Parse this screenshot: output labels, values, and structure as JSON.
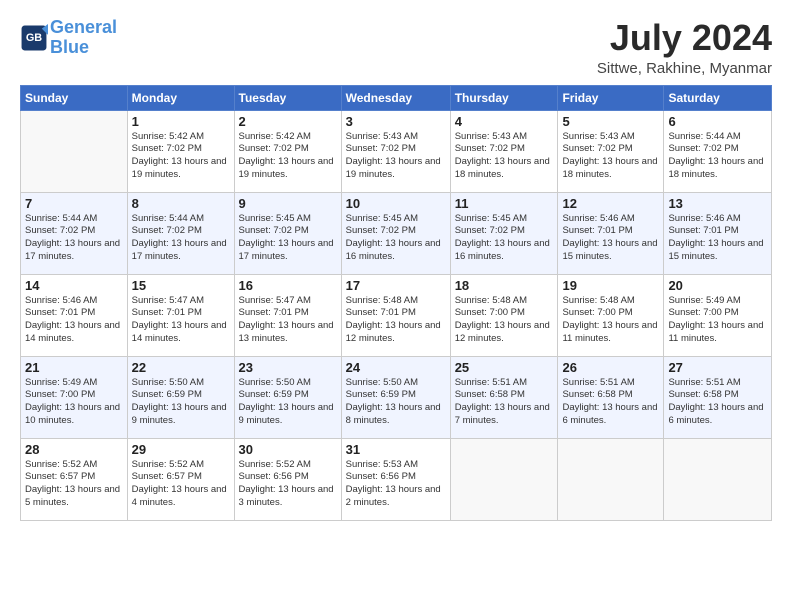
{
  "header": {
    "logo_line1": "General",
    "logo_line2": "Blue",
    "title": "July 2024",
    "location": "Sittwe, Rakhine, Myanmar"
  },
  "weekdays": [
    "Sunday",
    "Monday",
    "Tuesday",
    "Wednesday",
    "Thursday",
    "Friday",
    "Saturday"
  ],
  "weeks": [
    [
      {
        "day": "",
        "sunrise": "",
        "sunset": "",
        "daylight": ""
      },
      {
        "day": "1",
        "sunrise": "5:42 AM",
        "sunset": "7:02 PM",
        "daylight": "13 hours and 19 minutes."
      },
      {
        "day": "2",
        "sunrise": "5:42 AM",
        "sunset": "7:02 PM",
        "daylight": "13 hours and 19 minutes."
      },
      {
        "day": "3",
        "sunrise": "5:43 AM",
        "sunset": "7:02 PM",
        "daylight": "13 hours and 19 minutes."
      },
      {
        "day": "4",
        "sunrise": "5:43 AM",
        "sunset": "7:02 PM",
        "daylight": "13 hours and 18 minutes."
      },
      {
        "day": "5",
        "sunrise": "5:43 AM",
        "sunset": "7:02 PM",
        "daylight": "13 hours and 18 minutes."
      },
      {
        "day": "6",
        "sunrise": "5:44 AM",
        "sunset": "7:02 PM",
        "daylight": "13 hours and 18 minutes."
      }
    ],
    [
      {
        "day": "7",
        "sunrise": "5:44 AM",
        "sunset": "7:02 PM",
        "daylight": "13 hours and 17 minutes."
      },
      {
        "day": "8",
        "sunrise": "5:44 AM",
        "sunset": "7:02 PM",
        "daylight": "13 hours and 17 minutes."
      },
      {
        "day": "9",
        "sunrise": "5:45 AM",
        "sunset": "7:02 PM",
        "daylight": "13 hours and 17 minutes."
      },
      {
        "day": "10",
        "sunrise": "5:45 AM",
        "sunset": "7:02 PM",
        "daylight": "13 hours and 16 minutes."
      },
      {
        "day": "11",
        "sunrise": "5:45 AM",
        "sunset": "7:02 PM",
        "daylight": "13 hours and 16 minutes."
      },
      {
        "day": "12",
        "sunrise": "5:46 AM",
        "sunset": "7:01 PM",
        "daylight": "13 hours and 15 minutes."
      },
      {
        "day": "13",
        "sunrise": "5:46 AM",
        "sunset": "7:01 PM",
        "daylight": "13 hours and 15 minutes."
      }
    ],
    [
      {
        "day": "14",
        "sunrise": "5:46 AM",
        "sunset": "7:01 PM",
        "daylight": "13 hours and 14 minutes."
      },
      {
        "day": "15",
        "sunrise": "5:47 AM",
        "sunset": "7:01 PM",
        "daylight": "13 hours and 14 minutes."
      },
      {
        "day": "16",
        "sunrise": "5:47 AM",
        "sunset": "7:01 PM",
        "daylight": "13 hours and 13 minutes."
      },
      {
        "day": "17",
        "sunrise": "5:48 AM",
        "sunset": "7:01 PM",
        "daylight": "13 hours and 12 minutes."
      },
      {
        "day": "18",
        "sunrise": "5:48 AM",
        "sunset": "7:00 PM",
        "daylight": "13 hours and 12 minutes."
      },
      {
        "day": "19",
        "sunrise": "5:48 AM",
        "sunset": "7:00 PM",
        "daylight": "13 hours and 11 minutes."
      },
      {
        "day": "20",
        "sunrise": "5:49 AM",
        "sunset": "7:00 PM",
        "daylight": "13 hours and 11 minutes."
      }
    ],
    [
      {
        "day": "21",
        "sunrise": "5:49 AM",
        "sunset": "7:00 PM",
        "daylight": "13 hours and 10 minutes."
      },
      {
        "day": "22",
        "sunrise": "5:50 AM",
        "sunset": "6:59 PM",
        "daylight": "13 hours and 9 minutes."
      },
      {
        "day": "23",
        "sunrise": "5:50 AM",
        "sunset": "6:59 PM",
        "daylight": "13 hours and 9 minutes."
      },
      {
        "day": "24",
        "sunrise": "5:50 AM",
        "sunset": "6:59 PM",
        "daylight": "13 hours and 8 minutes."
      },
      {
        "day": "25",
        "sunrise": "5:51 AM",
        "sunset": "6:58 PM",
        "daylight": "13 hours and 7 minutes."
      },
      {
        "day": "26",
        "sunrise": "5:51 AM",
        "sunset": "6:58 PM",
        "daylight": "13 hours and 6 minutes."
      },
      {
        "day": "27",
        "sunrise": "5:51 AM",
        "sunset": "6:58 PM",
        "daylight": "13 hours and 6 minutes."
      }
    ],
    [
      {
        "day": "28",
        "sunrise": "5:52 AM",
        "sunset": "6:57 PM",
        "daylight": "13 hours and 5 minutes."
      },
      {
        "day": "29",
        "sunrise": "5:52 AM",
        "sunset": "6:57 PM",
        "daylight": "13 hours and 4 minutes."
      },
      {
        "day": "30",
        "sunrise": "5:52 AM",
        "sunset": "6:56 PM",
        "daylight": "13 hours and 3 minutes."
      },
      {
        "day": "31",
        "sunrise": "5:53 AM",
        "sunset": "6:56 PM",
        "daylight": "13 hours and 2 minutes."
      },
      {
        "day": "",
        "sunrise": "",
        "sunset": "",
        "daylight": ""
      },
      {
        "day": "",
        "sunrise": "",
        "sunset": "",
        "daylight": ""
      },
      {
        "day": "",
        "sunrise": "",
        "sunset": "",
        "daylight": ""
      }
    ]
  ],
  "labels": {
    "sunrise_prefix": "Sunrise: ",
    "sunset_prefix": "Sunset: ",
    "daylight_prefix": "Daylight: "
  }
}
